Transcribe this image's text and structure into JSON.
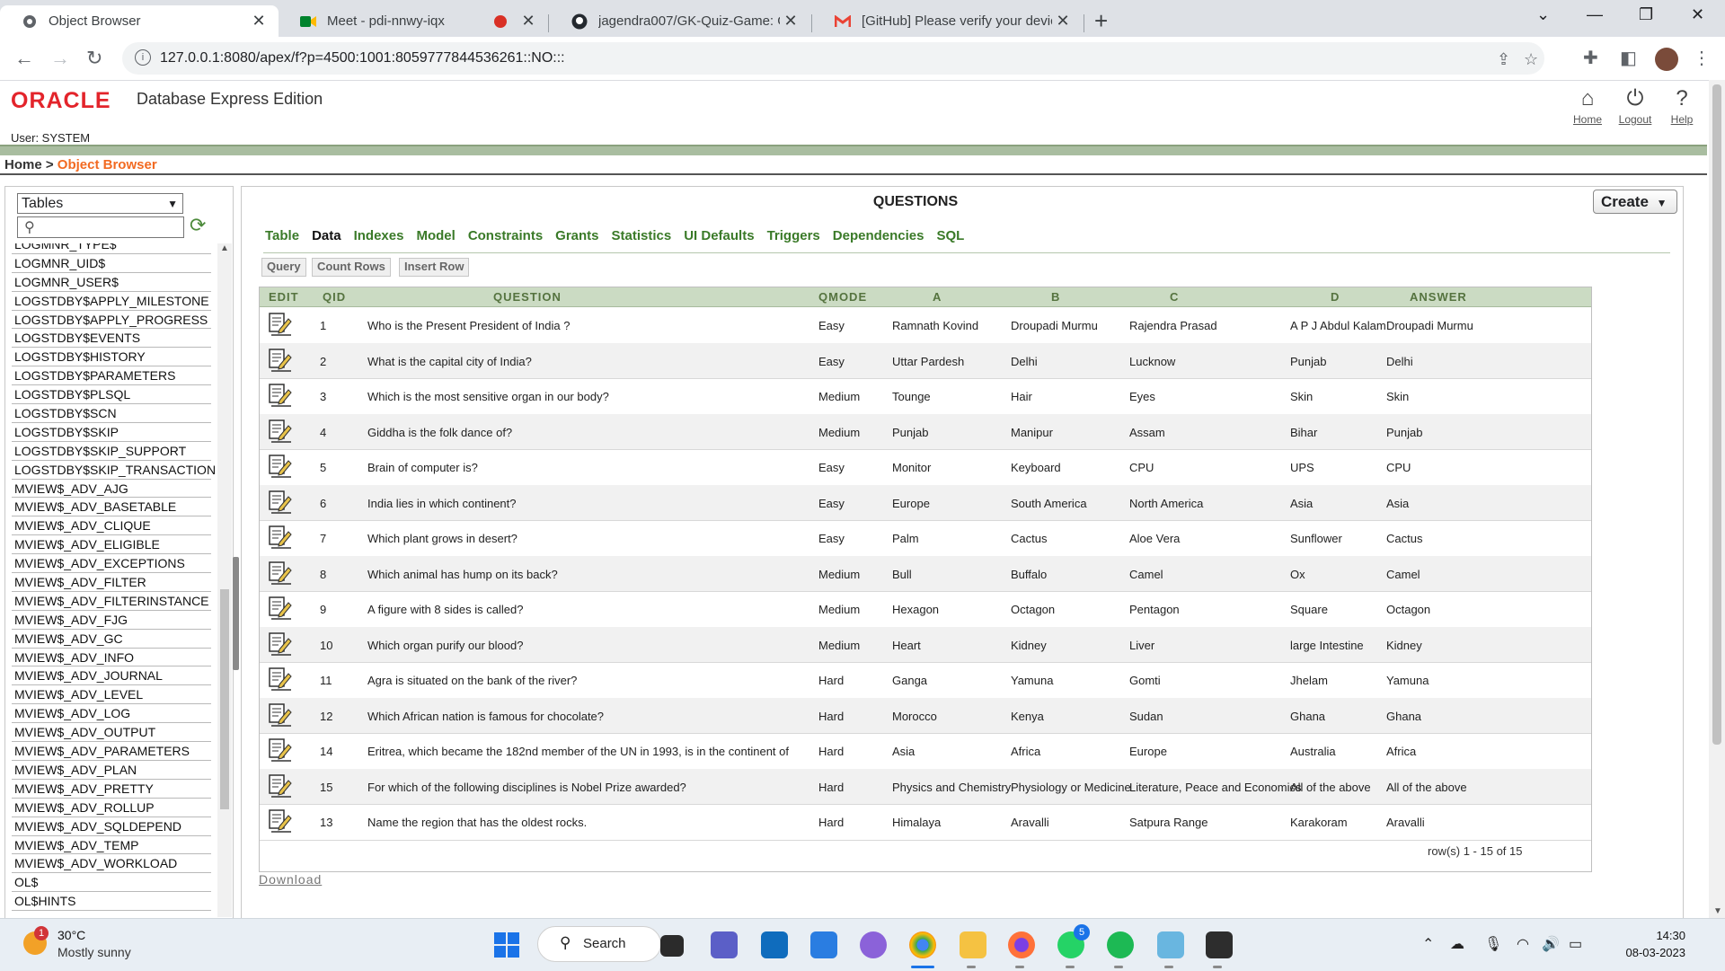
{
  "browser": {
    "tabs": [
      {
        "title": "Object Browser",
        "icon": "oracle-favicon"
      },
      {
        "title": "Meet - pdi-nnwy-iqx",
        "icon": "meet-icon"
      },
      {
        "title": "jagendra007/GK-Quiz-Game: GUI",
        "icon": "github-icon"
      },
      {
        "title": "[GitHub] Please verify your device",
        "icon": "gmail-icon"
      }
    ],
    "url": "127.0.0.1:8080/apex/f?p=4500:1001:8059777844536261::NO:::"
  },
  "app": {
    "product": "Database Express Edition",
    "logo_text": "ORACLE",
    "user_label": "User: SYSTEM",
    "header_links": [
      "Home",
      "Logout",
      "Help"
    ],
    "breadcrumb_home": "Home",
    "breadcrumb_sep": ">",
    "breadcrumb_current": "Object Browser"
  },
  "sidebar": {
    "object_type": "Tables",
    "objects": [
      "LOGMNR_TYPE$",
      "LOGMNR_UID$",
      "LOGMNR_USER$",
      "LOGSTDBY$APPLY_MILESTONE",
      "LOGSTDBY$APPLY_PROGRESS",
      "LOGSTDBY$EVENTS",
      "LOGSTDBY$HISTORY",
      "LOGSTDBY$PARAMETERS",
      "LOGSTDBY$PLSQL",
      "LOGSTDBY$SCN",
      "LOGSTDBY$SKIP",
      "LOGSTDBY$SKIP_SUPPORT",
      "LOGSTDBY$SKIP_TRANSACTION",
      "MVIEW$_ADV_AJG",
      "MVIEW$_ADV_BASETABLE",
      "MVIEW$_ADV_CLIQUE",
      "MVIEW$_ADV_ELIGIBLE",
      "MVIEW$_ADV_EXCEPTIONS",
      "MVIEW$_ADV_FILTER",
      "MVIEW$_ADV_FILTERINSTANCE",
      "MVIEW$_ADV_FJG",
      "MVIEW$_ADV_GC",
      "MVIEW$_ADV_INFO",
      "MVIEW$_ADV_JOURNAL",
      "MVIEW$_ADV_LEVEL",
      "MVIEW$_ADV_LOG",
      "MVIEW$_ADV_OUTPUT",
      "MVIEW$_ADV_PARAMETERS",
      "MVIEW$_ADV_PLAN",
      "MVIEW$_ADV_PRETTY",
      "MVIEW$_ADV_ROLLUP",
      "MVIEW$_ADV_SQLDEPEND",
      "MVIEW$_ADV_TEMP",
      "MVIEW$_ADV_WORKLOAD",
      "OL$",
      "OL$HINTS"
    ]
  },
  "main": {
    "object_name": "QUESTIONS",
    "create_label": "Create",
    "tabs": [
      "Table",
      "Data",
      "Indexes",
      "Model",
      "Constraints",
      "Grants",
      "Statistics",
      "UI Defaults",
      "Triggers",
      "Dependencies",
      "SQL"
    ],
    "active_tab": "Data",
    "actions": [
      "Query",
      "Count Rows",
      "Insert Row"
    ],
    "columns": [
      "EDIT",
      "QID",
      "QUESTION",
      "QMODE",
      "A",
      "B",
      "C",
      "D",
      "ANSWER"
    ],
    "rows": [
      [
        "1",
        "Who is the Present President of India ?",
        "Easy",
        "Ramnath Kovind",
        "Droupadi Murmu",
        "Rajendra Prasad",
        "A P J Abdul Kalam",
        "Droupadi Murmu"
      ],
      [
        "2",
        "What is the capital city of India?",
        "Easy",
        "Uttar Pardesh",
        "Delhi",
        "Lucknow",
        "Punjab",
        "Delhi"
      ],
      [
        "3",
        "Which is the most sensitive organ in our body?",
        "Medium",
        "Tounge",
        "Hair",
        "Eyes",
        "Skin",
        "Skin"
      ],
      [
        "4",
        "Giddha is the folk dance of?",
        "Medium",
        "Punjab",
        "Manipur",
        "Assam",
        "Bihar",
        "Punjab"
      ],
      [
        "5",
        "Brain of computer is?",
        "Easy",
        "Monitor",
        "Keyboard",
        "CPU",
        "UPS",
        "CPU"
      ],
      [
        "6",
        "India lies in which continent?",
        "Easy",
        "Europe",
        "South America",
        "North America",
        "Asia",
        "Asia"
      ],
      [
        "7",
        "Which plant grows in desert?",
        "Easy",
        "Palm",
        "Cactus",
        "Aloe Vera",
        "Sunflower",
        "Cactus"
      ],
      [
        "8",
        "Which animal has hump on its back?",
        "Medium",
        "Bull",
        "Buffalo",
        "Camel",
        "Ox",
        "Camel"
      ],
      [
        "9",
        "A figure with 8 sides is called?",
        "Medium",
        "Hexagon",
        "Octagon",
        "Pentagon",
        "Square",
        "Octagon"
      ],
      [
        "10",
        "Which organ purify our blood?",
        "Medium",
        "Heart",
        "Kidney",
        "Liver",
        "large Intestine",
        "Kidney"
      ],
      [
        "11",
        "Agra is situated on the bank of the river?",
        "Hard",
        "Ganga",
        "Yamuna",
        "Gomti",
        "Jhelam",
        "Yamuna"
      ],
      [
        "12",
        "Which African nation is famous for chocolate?",
        "Hard",
        "Morocco",
        "Kenya",
        "Sudan",
        "Ghana",
        "Ghana"
      ],
      [
        "14",
        "Eritrea, which became the 182nd member of the UN in 1993, is in the continent of",
        "Hard",
        "Asia",
        "Africa",
        "Europe",
        "Australia",
        "Africa"
      ],
      [
        "15",
        "For which of the following disciplines is Nobel Prize awarded?",
        "Hard",
        "Physics and Chemistry",
        "Physiology or Medicine",
        "Literature, Peace and Economics",
        "All of the above",
        "All of the above"
      ],
      [
        "13",
        "Name the region that has the oldest rocks.",
        "Hard",
        "Himalaya",
        "Aravalli",
        "Satpura Range",
        "Karakoram",
        "Aravalli"
      ]
    ],
    "row_count": "row(s) 1 - 15 of 15",
    "download_label": "Download"
  },
  "taskbar": {
    "weather_temp": "30°C",
    "weather_desc": "Mostly sunny",
    "weather_badge": "1",
    "search_label": "Search",
    "whatsapp_badge": "5",
    "time": "14:30",
    "date": "08-03-2023"
  }
}
